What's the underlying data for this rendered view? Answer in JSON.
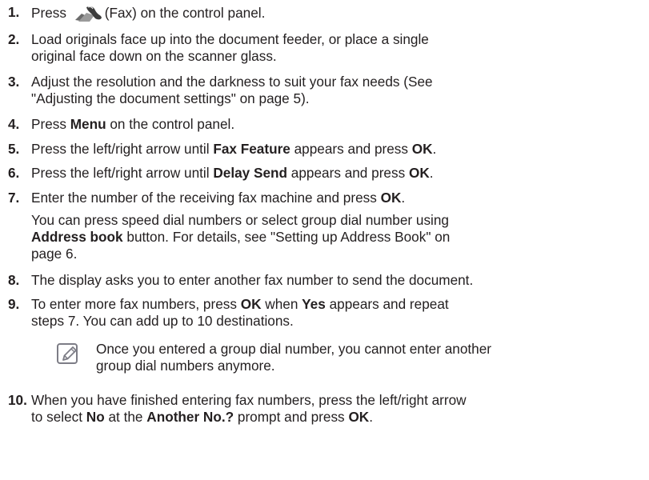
{
  "steps": [
    {
      "num": "1.",
      "parts": [
        {
          "t": "Press "
        },
        {
          "icon": "fax-icon"
        },
        {
          "t": "(Fax) on the control panel."
        }
      ]
    },
    {
      "num": "2.",
      "lines": [
        [
          {
            "t": "Load originals face up into the document feeder, or place a single"
          }
        ],
        [
          {
            "t": "original face down on the scanner glass."
          }
        ]
      ]
    },
    {
      "num": "3.",
      "lines": [
        [
          {
            "t": "Adjust the resolution and the darkness to suit your fax needs (See"
          }
        ],
        [
          {
            "t": "\"Adjusting the document settings\" on page 5)."
          }
        ]
      ]
    },
    {
      "num": "4.",
      "lines": [
        [
          {
            "t": "Press "
          },
          {
            "b": "Menu"
          },
          {
            "t": " on the control panel."
          }
        ]
      ]
    },
    {
      "num": "5.",
      "lines": [
        [
          {
            "t": "Press the left/right arrow until "
          },
          {
            "b": "Fax Feature"
          },
          {
            "t": " appears and press "
          },
          {
            "b": "OK"
          },
          {
            "t": "."
          }
        ]
      ]
    },
    {
      "num": "6.",
      "lines": [
        [
          {
            "t": "Press the left/right arrow until "
          },
          {
            "b": "Delay Send"
          },
          {
            "t": " appears and press "
          },
          {
            "b": "OK"
          },
          {
            "t": "."
          }
        ]
      ]
    },
    {
      "num": "7.",
      "lines": [
        [
          {
            "t": "Enter the number of the receiving fax machine and press "
          },
          {
            "b": "OK"
          },
          {
            "t": "."
          }
        ]
      ]
    },
    {
      "num": "",
      "lines": [
        [
          {
            "t": "You can press speed dial numbers or select group dial number using"
          }
        ],
        [
          {
            "b": "Address book"
          },
          {
            "t": " button. For details, see \"Setting up Address Book\" on"
          }
        ],
        [
          {
            "t": "page 6."
          }
        ]
      ]
    },
    {
      "num": "8.",
      "lines": [
        [
          {
            "t": "The display asks you to enter another fax number to send the document."
          }
        ]
      ]
    },
    {
      "num": "9.",
      "lines": [
        [
          {
            "t": "To enter more fax numbers, press "
          },
          {
            "b": "OK"
          },
          {
            "t": " when "
          },
          {
            "b": "Yes"
          },
          {
            "t": " appears and repeat"
          }
        ],
        [
          {
            "t": "steps 7. You can add up to 10 destinations."
          }
        ]
      ]
    },
    {
      "num": "10.",
      "lines": [
        [
          {
            "t": "When you have finished entering fax numbers, press the left/right arrow"
          }
        ],
        [
          {
            "t": "to select "
          },
          {
            "b": "No"
          },
          {
            "t": " at the "
          },
          {
            "b": "Another No.?"
          },
          {
            "t": " prompt and press "
          },
          {
            "b": "OK"
          },
          {
            "t": "."
          }
        ]
      ]
    }
  ],
  "note": {
    "icon": "note-pencil-icon",
    "lines": [
      "Once you entered a group dial number, you cannot enter another",
      "group dial numbers anymore."
    ]
  }
}
